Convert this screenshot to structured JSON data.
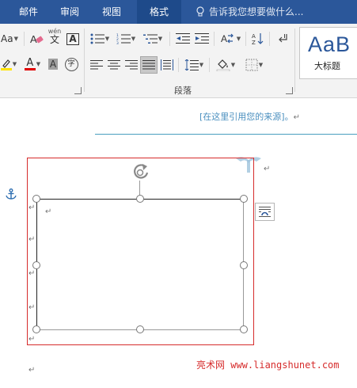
{
  "tabs": [
    {
      "label": "邮件",
      "active": false
    },
    {
      "label": "审阅",
      "active": false
    },
    {
      "label": "视图",
      "active": false
    },
    {
      "label": "格式",
      "active": true
    }
  ],
  "tell_me": {
    "placeholder": "告诉我您想要做什么..."
  },
  "ribbon": {
    "font_size_label": "Aa",
    "phonetic_label": "wén",
    "phonetic_char": "文",
    "border_char": "A",
    "font_color_char": "A",
    "shading_char": "A",
    "enclose_char": "字",
    "paragraph_group_label": "段落",
    "styles": {
      "sample": "AaB",
      "name": "大标题"
    }
  },
  "document": {
    "source_placeholder": "[在这里引用您的来源]。",
    "paragraph_mark": "↵"
  },
  "watermark": {
    "text": "亮术网 www.liangshunet.com"
  },
  "colors": {
    "tab_bar": "#2b579a",
    "selection_frame": "#d62c2c",
    "source_text": "#4a8fbf",
    "font_color_underline": "#e00000",
    "highlight_underline": "#ffe400"
  }
}
